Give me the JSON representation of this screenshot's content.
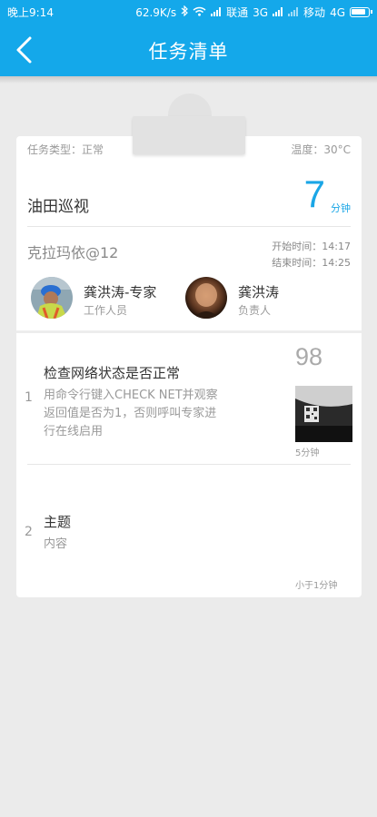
{
  "status_bar": {
    "time": "晚上9:14",
    "speed": "62.9K/s",
    "carrier1": "联通",
    "net1": "3G",
    "carrier2": "移动",
    "net2": "4G"
  },
  "header": {
    "title": "任务清单"
  },
  "task": {
    "type_label": "任务类型：正常",
    "temperature_label": "温度：30°C",
    "name": "油田巡视",
    "duration_value": "7",
    "duration_unit": "分钟",
    "location": "克拉玛依@12",
    "start_time": "开始时间：14:17",
    "end_time": "结束时间：14:25"
  },
  "people": [
    {
      "name": "龚洪涛-专家",
      "role": "工作人员"
    },
    {
      "name": "龚洪涛",
      "role": "负责人"
    }
  ],
  "steps": [
    {
      "index": "1",
      "title": "检查网络状态是否正常",
      "description_lines": [
        "用命令行键入CHECK NET并观察",
        "返回值是否为1，否则呼叫专家进",
        "行在线启用"
      ],
      "score": "98",
      "time": "5分钟"
    },
    {
      "index": "2",
      "title": "主题",
      "description_lines": [
        "内容"
      ],
      "score": "",
      "time": "小于1分钟"
    }
  ],
  "colors": {
    "primary": "#14a8ea",
    "accent_number": "#1aa6e6",
    "background": "#ebebeb"
  },
  "icons": {
    "back": "chevron-left-icon",
    "bluetooth": "bluetooth-icon",
    "wifi": "wifi-icon",
    "signal": "signal-icon",
    "battery": "battery-icon"
  }
}
